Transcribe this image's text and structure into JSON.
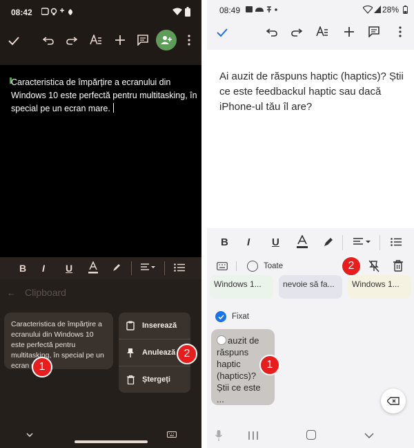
{
  "left": {
    "status": {
      "time": "08:42"
    },
    "document_text": "Caracteristica de împărțire a ecranului din Windows 10 este perfectă pentru multitasking, în special pe un ecran mare.",
    "clipboard": {
      "title": "Clipboard",
      "hint": "",
      "item_text": "Caracteristica de împărțire a ecranului din Windows 10 este perfectă pentru multitasking, în special pe un ecran mare."
    },
    "menu": {
      "paste": "Inserează",
      "unpin": "Anulează",
      "delete": "Ștergeți"
    },
    "badges": [
      "1",
      "2"
    ]
  },
  "right": {
    "status": {
      "time": "08:49",
      "battery": "28%"
    },
    "document_text": "Ai auzit de răspuns haptic (haptics)? Știi ce este feedbackul haptic sau dacă iPhone-ul tău îl are?",
    "clipboard": {
      "select_all": "Toate",
      "chips": [
        "Windows 1...",
        "nevoie să fa...",
        "Windows 1..."
      ],
      "pinned_label": "Fixat",
      "pinned_text": "auzit de răspuns haptic (haptics)? Știi ce este ..."
    },
    "badges": [
      "2",
      "1"
    ]
  },
  "colors": {
    "left_bg": "#201a17",
    "left_accent": "#5e9c5a",
    "right_accent": "#1a73e8",
    "badge": "#e81d1d"
  }
}
